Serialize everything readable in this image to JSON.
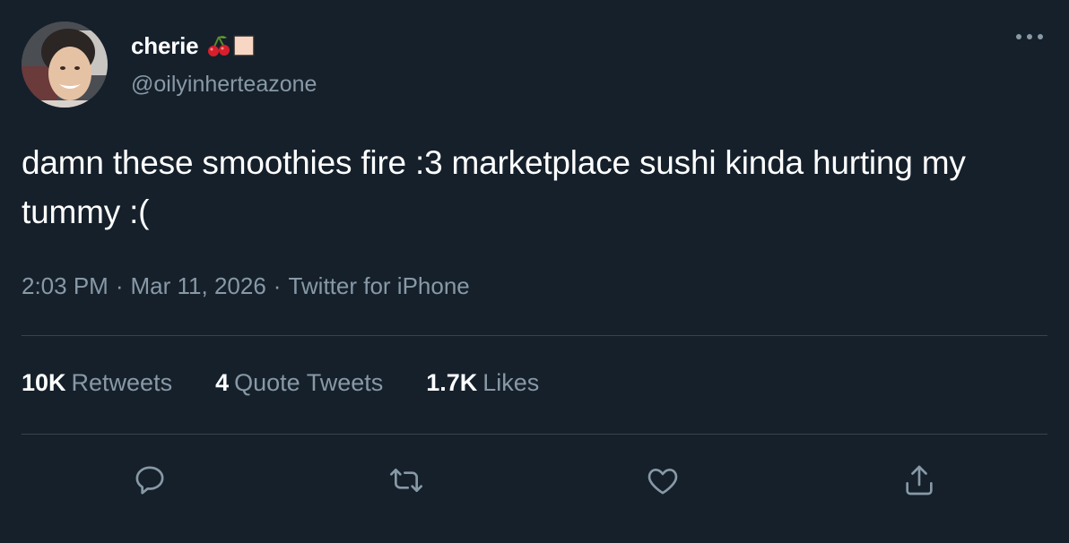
{
  "user": {
    "display_name": "cherie",
    "handle": "@oilyinherteazone",
    "name_emojis": [
      "cherries-emoji",
      "peach-square-emoji"
    ]
  },
  "tweet": {
    "text": "damn these smoothies fire :3 marketplace sushi kinda hurting my tummy :("
  },
  "meta": {
    "time": "2:03 PM",
    "separator": "·",
    "date": "Mar 11, 2026",
    "source": "Twitter for iPhone"
  },
  "stats": {
    "retweets_count": "10K",
    "retweets_label": "Retweets",
    "quotes_count": "4",
    "quotes_label": "Quote Tweets",
    "likes_count": "1.7K",
    "likes_label": "Likes"
  },
  "actions": {
    "icons": [
      "reply-icon",
      "retweet-icon",
      "like-icon",
      "share-icon"
    ]
  },
  "colors": {
    "background": "#15202b",
    "primary_text": "#ffffff",
    "secondary_text": "#8899a6",
    "divider": "#38444d"
  }
}
